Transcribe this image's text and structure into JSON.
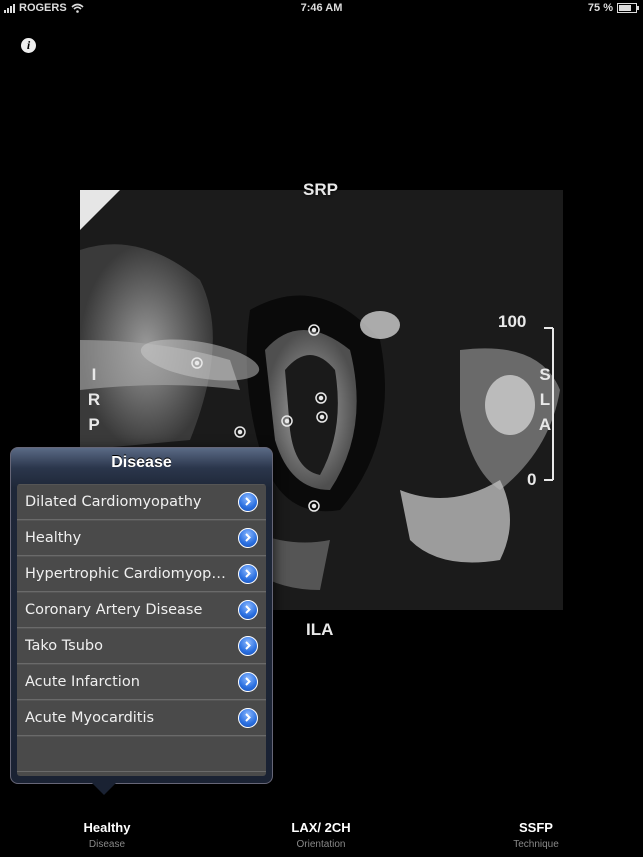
{
  "status_bar": {
    "carrier": "ROGERS",
    "time": "7:46 AM",
    "battery": "75 %"
  },
  "orientation_labels": {
    "top": "SRP",
    "bottom": "ILA",
    "left": [
      "I",
      "R",
      "P"
    ],
    "right": [
      "S",
      "L",
      "A"
    ]
  },
  "scale": {
    "max": "100",
    "min": "0"
  },
  "popover": {
    "title": "Disease",
    "items": [
      {
        "label": "Dilated Cardiomyopathy"
      },
      {
        "label": "Healthy"
      },
      {
        "label": "Hypertrophic Cardiomyopa…"
      },
      {
        "label": "Coronary Artery Disease"
      },
      {
        "label": "Tako Tsubo"
      },
      {
        "label": "Acute Infarction"
      },
      {
        "label": "Acute Myocarditis"
      }
    ]
  },
  "tabs": [
    {
      "title": "Healthy",
      "subtitle": "Disease"
    },
    {
      "title": "LAX/ 2CH",
      "subtitle": "Orientation"
    },
    {
      "title": "SSFP",
      "subtitle": "Technique"
    }
  ],
  "colors": {
    "disclosure": "#2a6fe0",
    "popover": "#1a2233"
  }
}
